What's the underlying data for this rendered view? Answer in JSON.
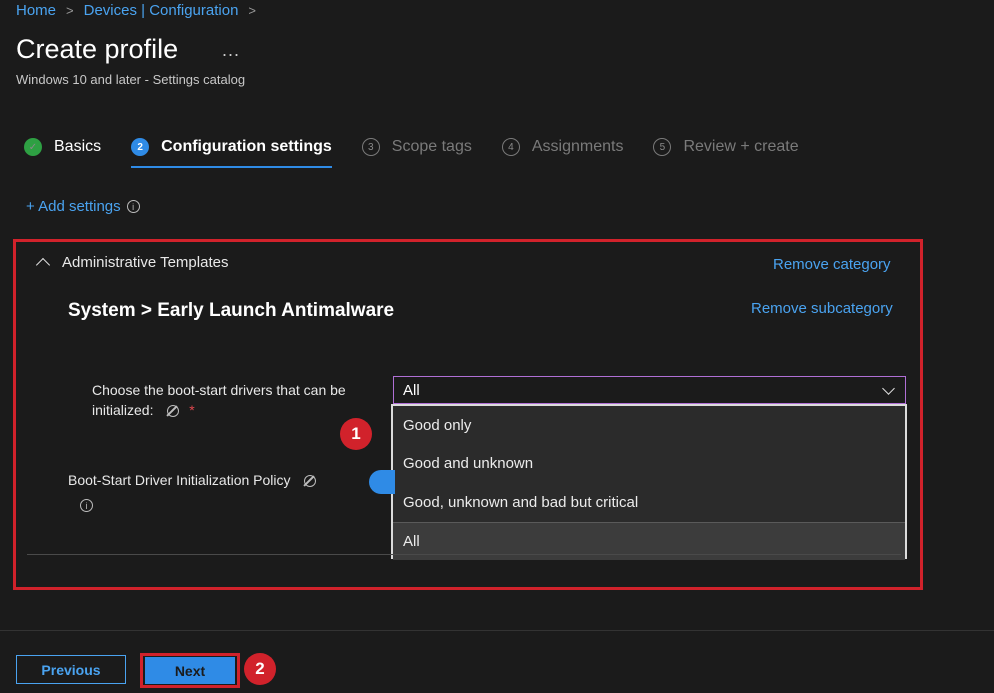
{
  "breadcrumb": {
    "items": [
      "Home",
      "Devices | Configuration"
    ]
  },
  "header": {
    "title": "Create profile",
    "more": "...",
    "subtitle": "Windows 10 and later - Settings catalog"
  },
  "steps": [
    {
      "num": "✓",
      "label": "Basics",
      "state": "done"
    },
    {
      "num": "2",
      "label": "Configuration settings",
      "state": "active"
    },
    {
      "num": "3",
      "label": "Scope tags",
      "state": "pending"
    },
    {
      "num": "4",
      "label": "Assignments",
      "state": "pending"
    },
    {
      "num": "5",
      "label": "Review + create",
      "state": "pending"
    }
  ],
  "add_settings": {
    "label": "+ Add settings"
  },
  "category": {
    "name": "Administrative Templates",
    "remove_category": "Remove category",
    "remove_subcategory": "Remove subcategory",
    "subcategory_title": "System > Early Launch Antimalware"
  },
  "field": {
    "label": "Choose the boot-start drivers that can be initialized:",
    "required_mark": "*",
    "selected_value": "All",
    "options": [
      "Good only",
      "Good and unknown",
      "Good, unknown and bad but critical",
      "All"
    ]
  },
  "policy": {
    "label": "Boot-Start Driver Initialization Policy"
  },
  "annotations": {
    "badge1": "1",
    "badge2": "2"
  },
  "footer": {
    "previous_label": "Previous",
    "next_label": "Next"
  },
  "colors": {
    "accent": "#2f8be6",
    "link": "#4aa3f0",
    "highlight": "#d1222b",
    "success": "#2ea043",
    "background": "#1b1b1b"
  }
}
